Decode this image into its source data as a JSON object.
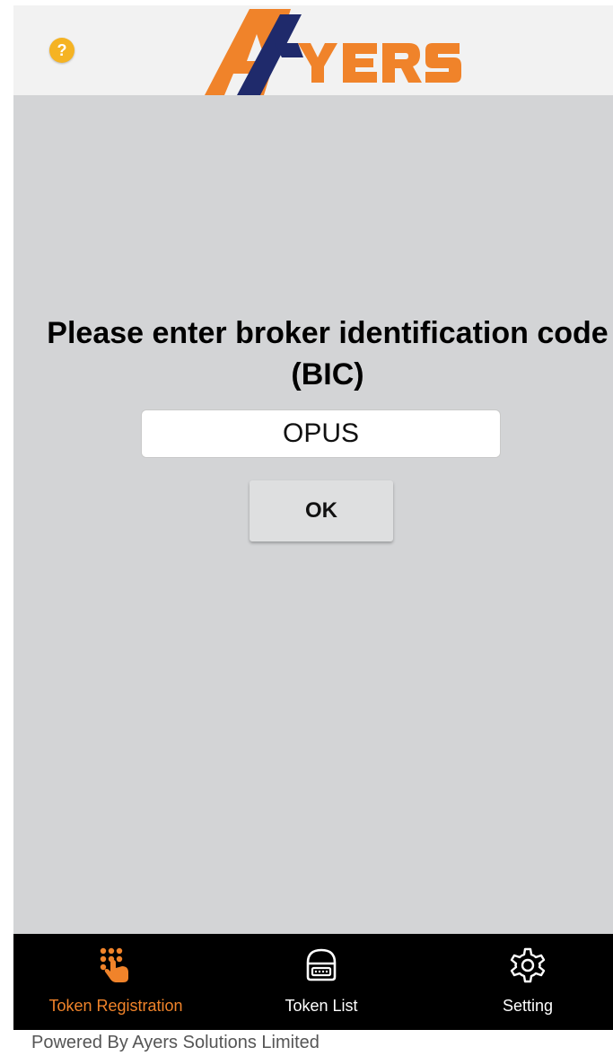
{
  "header": {
    "help_icon_label": "?",
    "logo": {
      "text": "AYERS",
      "colors": {
        "orange": "#f0832a",
        "navy": "#1f2a6b"
      }
    }
  },
  "main": {
    "prompt_line1": "Please enter broker identification code",
    "prompt_line2": "(BIC)",
    "bic_value": "OPUS",
    "ok_label": "OK"
  },
  "tabs": [
    {
      "label": "Token Registration",
      "icon": "keypad-hand-icon",
      "active": true
    },
    {
      "label": "Token List",
      "icon": "token-device-icon",
      "active": false
    },
    {
      "label": "Setting",
      "icon": "gear-icon",
      "active": false
    }
  ],
  "footer": {
    "text": "Powered By Ayers Solutions Limited"
  },
  "colors": {
    "accent": "#f0832a",
    "background": "#d3d4d6",
    "tabbar": "#000000"
  }
}
